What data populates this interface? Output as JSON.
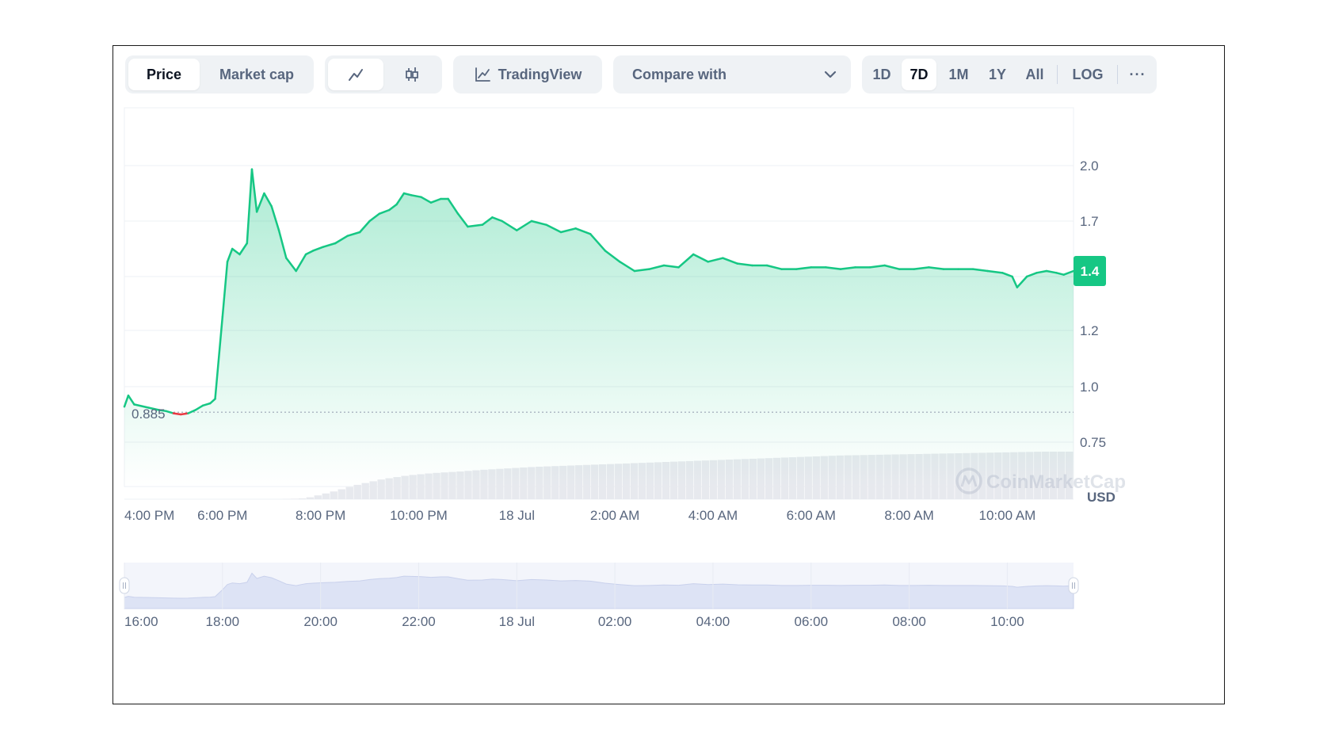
{
  "toolbar": {
    "metric_tabs": [
      "Price",
      "Market cap"
    ],
    "active_metric": "Price",
    "chart_style_icons": [
      "line-chart-icon",
      "candlestick-icon"
    ],
    "tradingview_label": "TradingView",
    "compare_label": "Compare with",
    "ranges": [
      "1D",
      "7D",
      "1M",
      "1Y",
      "All"
    ],
    "active_range": "7D",
    "log_label": "LOG",
    "more_label": "···"
  },
  "colors": {
    "up": "#16c784",
    "down": "#ea3943",
    "price_badge": "#16c784",
    "navigator_fill": "#dde3f5"
  },
  "watermark": "CoinMarketCap",
  "chart_data": {
    "type": "area",
    "currency_label": "USD",
    "x_tick_labels": [
      "4:00 PM",
      "6:00 PM",
      "8:00 PM",
      "10:00 PM",
      "18 Jul",
      "2:00 AM",
      "4:00 AM",
      "6:00 AM",
      "8:00 AM",
      "10:00 AM"
    ],
    "y_tick_labels": [
      "2.0",
      "1.7",
      "1.4",
      "1.2",
      "1.0",
      "0.75"
    ],
    "y_tick_values": [
      2.0,
      1.7,
      1.4,
      1.2,
      1.0,
      0.75
    ],
    "reference_price": 0.885,
    "reference_label": "0.885",
    "current_price_label": "1.4",
    "x_range_hours": [
      0,
      19.35
    ],
    "ylim": [
      0.6,
      2.1
    ],
    "series": [
      {
        "x": [
          0,
          0.08,
          0.2,
          0.5,
          0.7,
          0.85,
          1.0,
          1.15,
          1.3,
          1.45,
          1.6,
          1.75,
          1.85,
          2.0,
          2.1,
          2.2,
          2.35,
          2.5,
          2.6,
          2.7,
          2.85,
          3.0,
          3.15,
          3.3,
          3.5,
          3.7,
          3.85,
          4.05,
          4.3,
          4.55,
          4.8,
          5.0,
          5.2,
          5.4,
          5.55,
          5.7,
          5.85,
          6.05,
          6.25,
          6.45,
          6.6,
          6.8,
          7.0,
          7.3,
          7.5,
          7.7,
          8.0,
          8.3,
          8.6,
          8.9,
          9.2,
          9.5,
          9.8,
          10.1,
          10.4,
          10.7,
          11.0,
          11.3,
          11.6,
          11.9,
          12.2,
          12.5,
          12.8,
          13.1,
          13.4,
          13.7,
          14.0,
          14.3,
          14.6,
          14.9,
          15.2,
          15.5,
          15.8,
          16.1,
          16.4,
          16.7,
          17.0,
          17.3,
          17.6,
          17.9,
          18.1,
          18.2,
          18.4,
          18.6,
          18.8,
          19.0,
          19.15,
          19.35
        ],
        "y": [
          0.91,
          0.96,
          0.92,
          0.905,
          0.895,
          0.89,
          0.88,
          0.875,
          0.88,
          0.895,
          0.915,
          0.925,
          0.945,
          1.25,
          1.48,
          1.55,
          1.52,
          1.58,
          1.98,
          1.75,
          1.85,
          1.78,
          1.65,
          1.5,
          1.43,
          1.52,
          1.54,
          1.56,
          1.58,
          1.62,
          1.64,
          1.7,
          1.74,
          1.76,
          1.79,
          1.85,
          1.84,
          1.83,
          1.8,
          1.82,
          1.82,
          1.74,
          1.67,
          1.68,
          1.72,
          1.7,
          1.65,
          1.7,
          1.68,
          1.64,
          1.66,
          1.63,
          1.54,
          1.48,
          1.43,
          1.44,
          1.46,
          1.45,
          1.52,
          1.48,
          1.5,
          1.47,
          1.46,
          1.46,
          1.44,
          1.44,
          1.45,
          1.45,
          1.44,
          1.45,
          1.45,
          1.46,
          1.44,
          1.44,
          1.45,
          1.44,
          1.44,
          1.44,
          1.43,
          1.42,
          1.4,
          1.36,
          1.4,
          1.42,
          1.43,
          1.42,
          1.41,
          1.43
        ]
      }
    ],
    "volume_relative": [
      0,
      0,
      0,
      0,
      0,
      0,
      0,
      0.02,
      0.15,
      0.3,
      0.42,
      0.5,
      0.55,
      0.58,
      0.62,
      0.65,
      0.68,
      0.7,
      0.72,
      0.74,
      0.76,
      0.78,
      0.8,
      0.82,
      0.84,
      0.86,
      0.88,
      0.9,
      0.92,
      0.93,
      0.94,
      0.95,
      0.96,
      0.97,
      0.98,
      0.99,
      1.0,
      1.0
    ],
    "navigator_tick_labels": [
      "16:00",
      "18:00",
      "20:00",
      "22:00",
      "18 Jul",
      "02:00",
      "04:00",
      "06:00",
      "08:00",
      "10:00"
    ],
    "legend": "none",
    "grid": true
  }
}
